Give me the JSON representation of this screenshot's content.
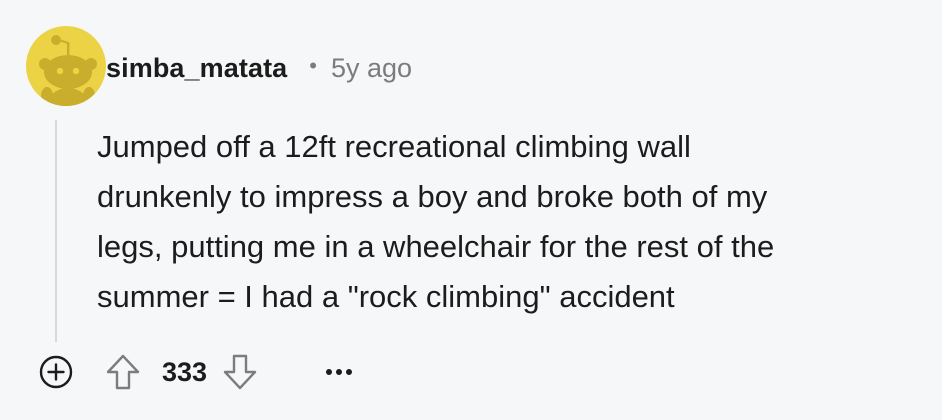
{
  "comment": {
    "username": "simba_matata",
    "separator": "•",
    "timestamp": "5y ago",
    "body": "Jumped off a 12ft recreational climbing wall\ndrunkenly to impress a boy and broke both of my\nlegs, putting me in a wheelchair for the rest of the\nsummer = I had a \"rock climbing\" accident",
    "score": "333"
  },
  "icons": {
    "avatar": "snoo-avatar-icon",
    "expand": "plus-circle-icon",
    "upvote": "arrow-up-icon",
    "downvote": "arrow-down-icon",
    "more": "ellipsis-icon"
  },
  "colors": {
    "background": "#f6f7f8",
    "avatar_bg": "#ecd346",
    "avatar_figure": "#c9ad2c",
    "muted": "#7c7c7c",
    "text": "#1c1c1c",
    "thread_line": "#d6d8da"
  }
}
